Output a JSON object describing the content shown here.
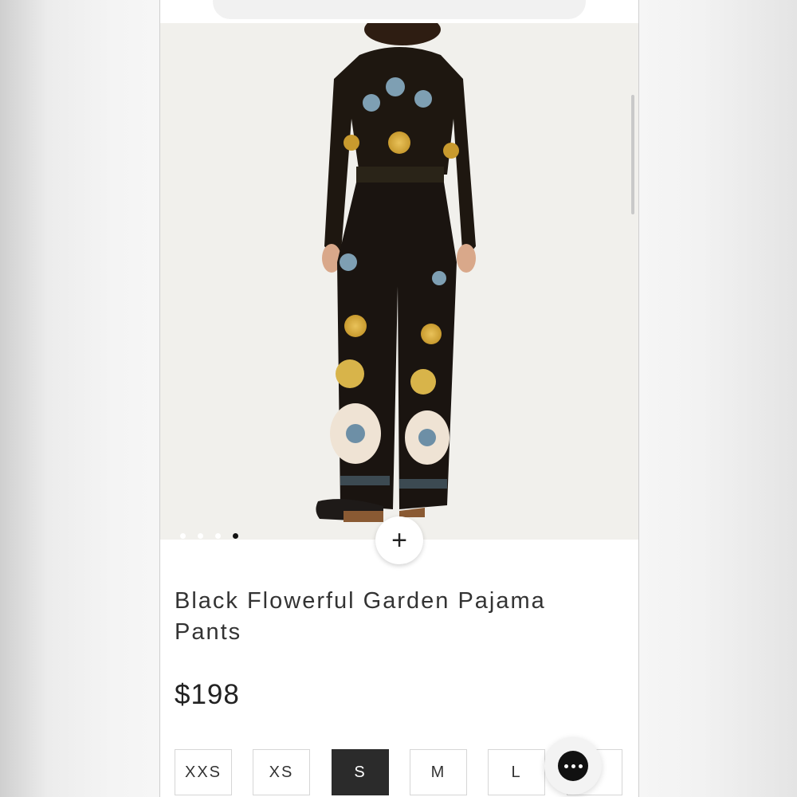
{
  "product": {
    "title": "Black Flowerful Garden Pajama Pants",
    "price": "$198",
    "image": {
      "carousel_slide_count": 4,
      "active_slide_index": 3
    }
  },
  "sizes": [
    {
      "label": "XXS",
      "selected": false
    },
    {
      "label": "XS",
      "selected": false
    },
    {
      "label": "S",
      "selected": true
    },
    {
      "label": "M",
      "selected": false
    },
    {
      "label": "L",
      "selected": false
    },
    {
      "label": "",
      "selected": false
    }
  ],
  "icons": {
    "add": "plus-icon",
    "chat": "chat-icon",
    "browser_left": "menu-icon",
    "browser_right": "bag-icon"
  },
  "colors": {
    "selected_size_bg": "#2b2b2b",
    "chat_bubble": "#111111",
    "image_background": "#f1f0ec"
  }
}
